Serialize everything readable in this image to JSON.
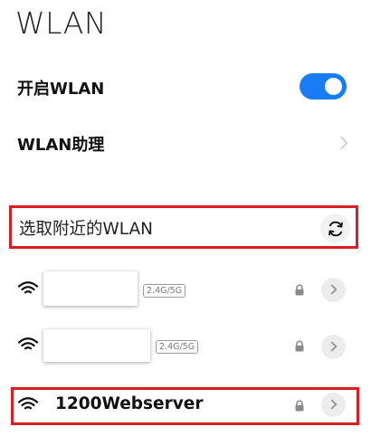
{
  "page": {
    "title": "WLAN"
  },
  "settings": {
    "toggle_label": "开启WLAN",
    "toggle_state": "on",
    "assistant_label": "WLAN助理"
  },
  "section": {
    "label": "选取附近的WLAN"
  },
  "networks": [
    {
      "ssid": "",
      "band": "2.4G/5G",
      "secured": true
    },
    {
      "ssid": "",
      "band": "2.4G/5G",
      "secured": true
    },
    {
      "ssid": "1200Webserver",
      "secured": true
    }
  ],
  "colors": {
    "accent": "#1a7cf5",
    "highlight": "#d91f26"
  },
  "icons": [
    "wifi-icon",
    "lock-icon",
    "refresh-icon",
    "chevron-right-icon"
  ]
}
